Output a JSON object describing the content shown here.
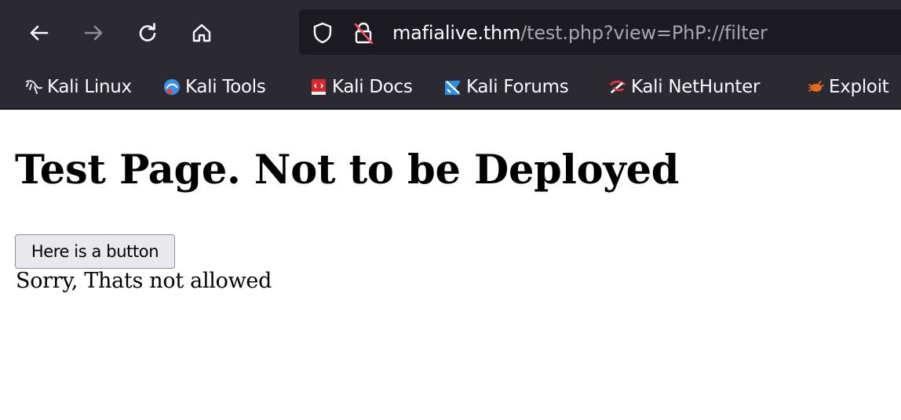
{
  "browser": {
    "nav": {
      "back_icon": "arrow-left-icon",
      "forward_icon": "arrow-right-icon",
      "reload_icon": "reload-icon",
      "home_icon": "home-icon"
    },
    "urlbar": {
      "host": "mafialive.thm",
      "path": "/test.php?view=PhP://filter",
      "tracking_icon": "shield-icon",
      "connection_icon": "insecure-lock-icon"
    },
    "bookmarks": [
      {
        "label": "Kali Linux",
        "icon": "kali-dragon-icon"
      },
      {
        "label": "Kali Tools",
        "icon": "kali-tools-icon"
      },
      {
        "label": "Kali Docs",
        "icon": "kali-docs-icon"
      },
      {
        "label": "Kali Forums",
        "icon": "kali-forums-icon"
      },
      {
        "label": "Kali NetHunter",
        "icon": "kali-nethunter-icon"
      },
      {
        "label": "Exploit",
        "icon": "exploit-db-icon"
      }
    ]
  },
  "page": {
    "title": "Test Page. Not to be Deployed",
    "button_label": "Here is a button",
    "message": "Sorry, Thats not allowed"
  },
  "colors": {
    "toolbar_bg": "#2b2a33",
    "urlbar_bg": "#1c1b22",
    "url_host": "#fbfbfe",
    "url_path": "#a7a6ae",
    "page_bg": "#ffffff"
  }
}
